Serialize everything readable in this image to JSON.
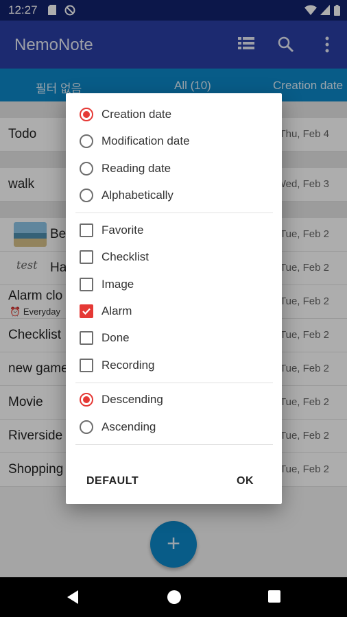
{
  "status_bar": {
    "time": "12:27"
  },
  "app_bar": {
    "title": "NemoNote",
    "icons": [
      "view-list-icon",
      "search-icon",
      "more-vert-icon"
    ]
  },
  "tabs": [
    {
      "label": "필터 없음"
    },
    {
      "label": "All (10)"
    },
    {
      "label": "Creation date"
    }
  ],
  "notes": [
    {
      "title": "Todo",
      "date": "Thu, Feb 4"
    },
    {
      "title": "walk",
      "date": "Wed, Feb 3"
    },
    {
      "title": "Be",
      "date": "Tue, Feb 2"
    },
    {
      "title": "Ha",
      "date": "Tue, Feb 2",
      "sketch": "test"
    },
    {
      "title": "Alarm clo",
      "date": "Tue, Feb 2",
      "sub": "Everyday"
    },
    {
      "title": "Checklist",
      "date": "Tue, Feb 2"
    },
    {
      "title": "new game",
      "date": "Tue, Feb 2"
    },
    {
      "title": "Movie",
      "date": "Tue, Feb 2"
    },
    {
      "title": "Riverside",
      "date": "Tue, Feb 2"
    },
    {
      "title": "Shopping",
      "date": "Tue, Feb 2"
    }
  ],
  "dialog": {
    "sort_options": [
      {
        "label": "Creation date",
        "selected": true
      },
      {
        "label": "Modification date",
        "selected": false
      },
      {
        "label": "Reading date",
        "selected": false
      },
      {
        "label": "Alphabetically",
        "selected": false
      }
    ],
    "filters": [
      {
        "label": "Favorite",
        "checked": false
      },
      {
        "label": "Checklist",
        "checked": false
      },
      {
        "label": "Image",
        "checked": false
      },
      {
        "label": "Alarm",
        "checked": true
      },
      {
        "label": "Done",
        "checked": false
      },
      {
        "label": "Recording",
        "checked": false
      }
    ],
    "order": [
      {
        "label": "Descending",
        "selected": true
      },
      {
        "label": "Ascending",
        "selected": false
      }
    ],
    "default_label": "DEFAULT",
    "ok_label": "OK"
  },
  "fab": {
    "label": "+"
  },
  "colors": {
    "accent": "#e53935",
    "primary": "#2a3fa6",
    "tab": "#0c88c9"
  }
}
